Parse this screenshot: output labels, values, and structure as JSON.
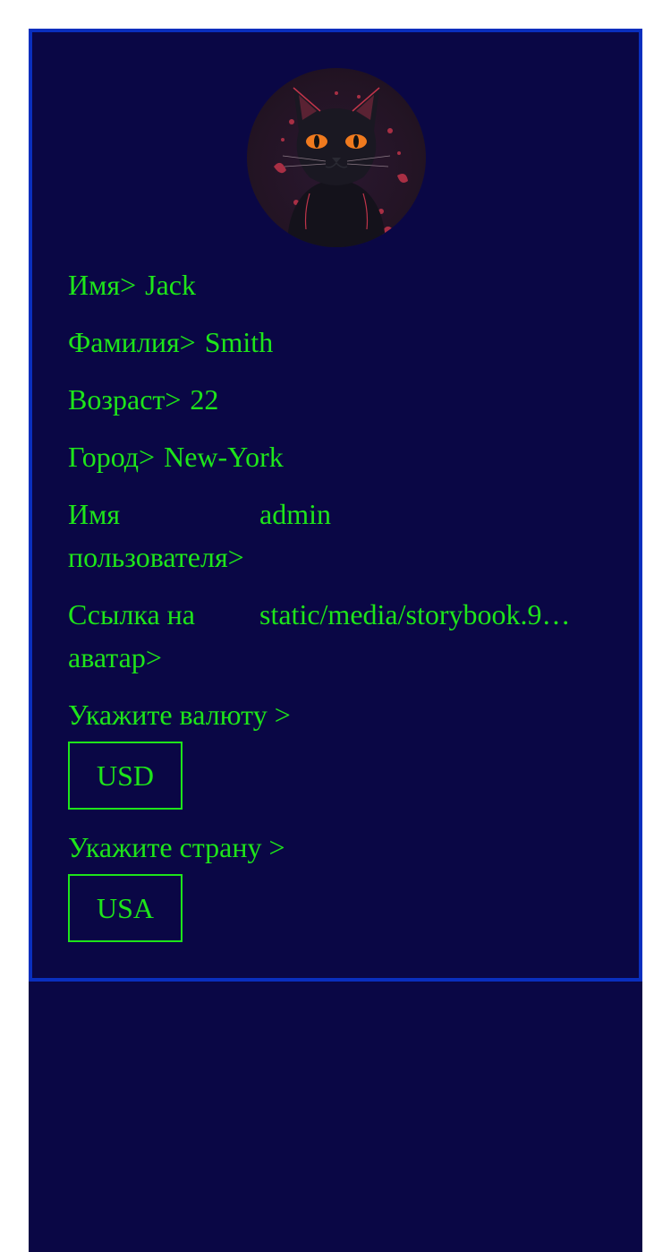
{
  "profile": {
    "avatar_alt": "avatar",
    "fields": [
      {
        "label": "Имя>",
        "value": "Jack"
      },
      {
        "label": "Фамилия>",
        "value": "Smith"
      },
      {
        "label": "Возраст>",
        "value": "22"
      },
      {
        "label": "Город>",
        "value": "New-York"
      },
      {
        "label": "Имя пользователя>",
        "value": "admin"
      },
      {
        "label": "Ссылка на аватар>",
        "value": "static/media/storybook.9…"
      }
    ],
    "currency": {
      "label": "Укажите валюту >",
      "selected": "USD"
    },
    "country": {
      "label": "Укажите страну >",
      "selected": "USA"
    }
  },
  "colors": {
    "background": "#0a0745",
    "border": "#0a2fbe",
    "text": "#1ee51a"
  }
}
